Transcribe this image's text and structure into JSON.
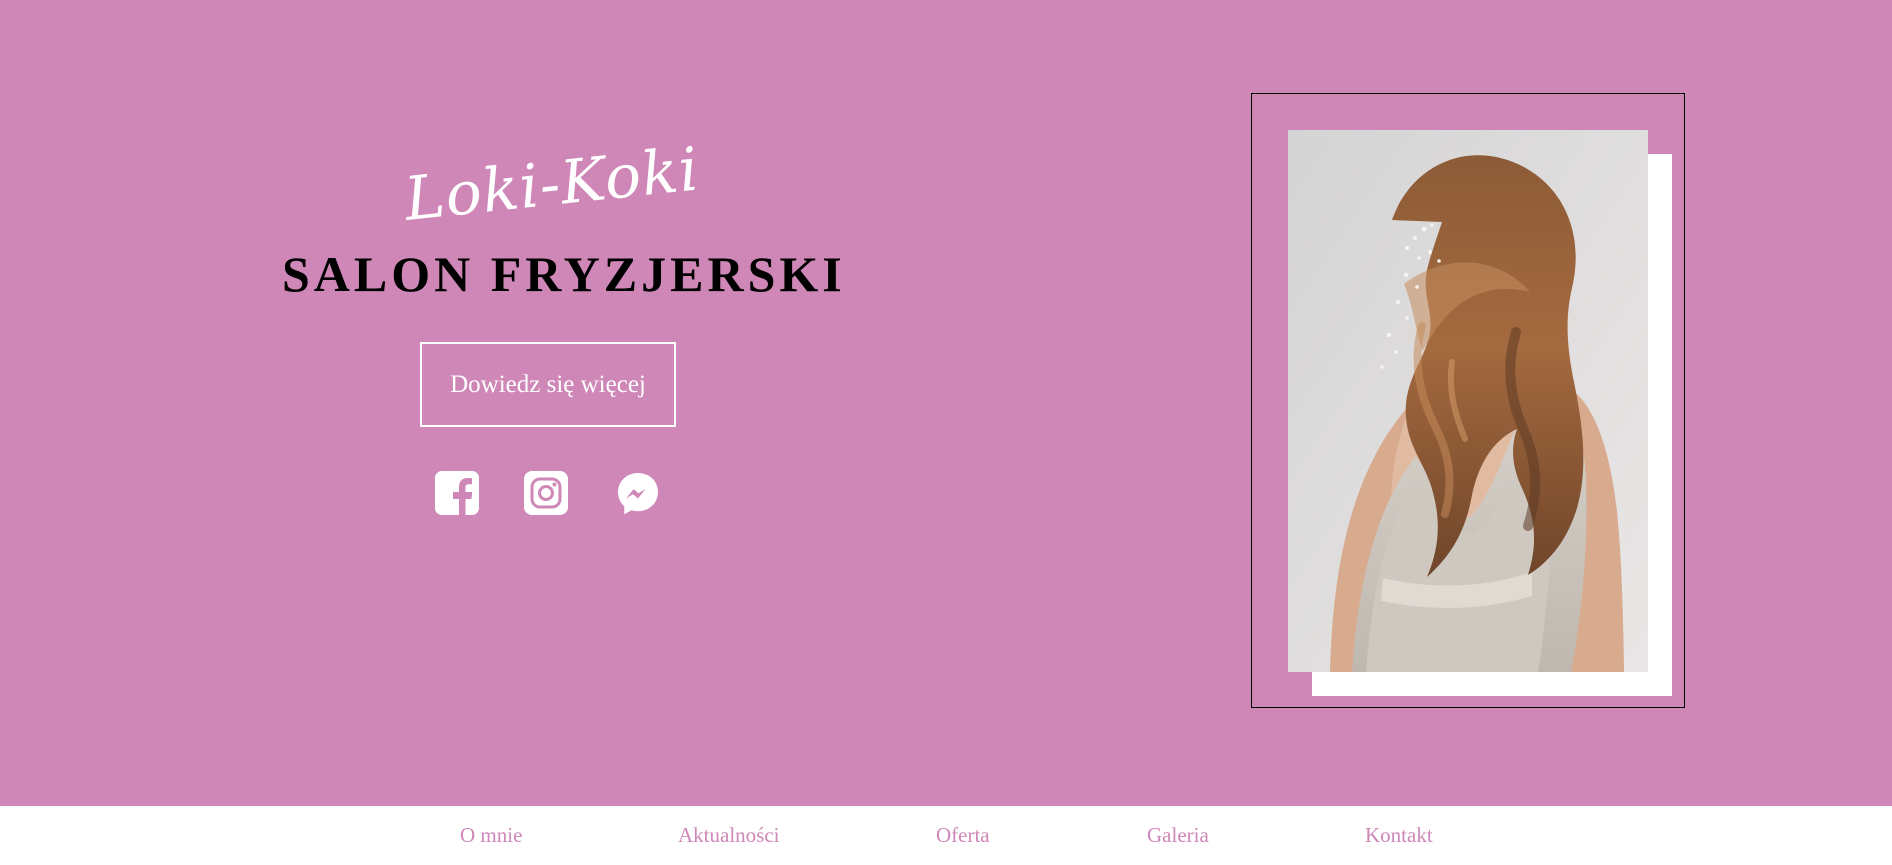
{
  "brand": {
    "script_name": "Loki-Koki",
    "title": "SALON FRYZJERSKI"
  },
  "hero": {
    "cta_label": "Dowiedz się więcej",
    "background_color": "#cf87b7",
    "social_icons": [
      "facebook-icon",
      "instagram-icon",
      "messenger-icon"
    ]
  },
  "nav": {
    "items": [
      {
        "label": "O mnie"
      },
      {
        "label": "Aktualności"
      },
      {
        "label": "Oferta"
      },
      {
        "label": "Galeria"
      },
      {
        "label": "Kontakt"
      }
    ]
  },
  "colors": {
    "accent": "#cf87b7",
    "text_dark": "#000000",
    "text_light": "#ffffff"
  }
}
